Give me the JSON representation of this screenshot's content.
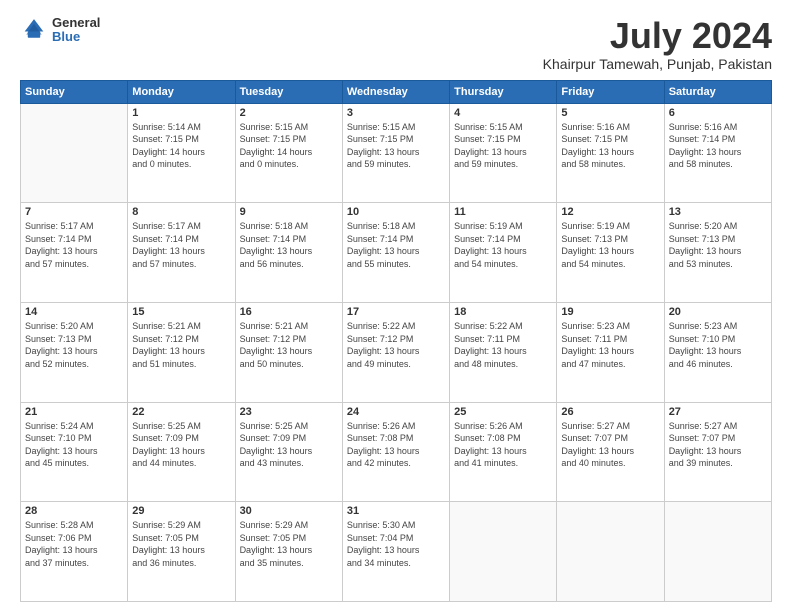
{
  "logo": {
    "line1": "General",
    "line2": "Blue"
  },
  "title": "July 2024",
  "location": "Khairpur Tamewah, Punjab, Pakistan",
  "headers": [
    "Sunday",
    "Monday",
    "Tuesday",
    "Wednesday",
    "Thursday",
    "Friday",
    "Saturday"
  ],
  "weeks": [
    [
      {
        "day": "",
        "info": ""
      },
      {
        "day": "1",
        "info": "Sunrise: 5:14 AM\nSunset: 7:15 PM\nDaylight: 14 hours\nand 0 minutes."
      },
      {
        "day": "2",
        "info": "Sunrise: 5:15 AM\nSunset: 7:15 PM\nDaylight: 14 hours\nand 0 minutes."
      },
      {
        "day": "3",
        "info": "Sunrise: 5:15 AM\nSunset: 7:15 PM\nDaylight: 13 hours\nand 59 minutes."
      },
      {
        "day": "4",
        "info": "Sunrise: 5:15 AM\nSunset: 7:15 PM\nDaylight: 13 hours\nand 59 minutes."
      },
      {
        "day": "5",
        "info": "Sunrise: 5:16 AM\nSunset: 7:15 PM\nDaylight: 13 hours\nand 58 minutes."
      },
      {
        "day": "6",
        "info": "Sunrise: 5:16 AM\nSunset: 7:14 PM\nDaylight: 13 hours\nand 58 minutes."
      }
    ],
    [
      {
        "day": "7",
        "info": "Sunrise: 5:17 AM\nSunset: 7:14 PM\nDaylight: 13 hours\nand 57 minutes."
      },
      {
        "day": "8",
        "info": "Sunrise: 5:17 AM\nSunset: 7:14 PM\nDaylight: 13 hours\nand 57 minutes."
      },
      {
        "day": "9",
        "info": "Sunrise: 5:18 AM\nSunset: 7:14 PM\nDaylight: 13 hours\nand 56 minutes."
      },
      {
        "day": "10",
        "info": "Sunrise: 5:18 AM\nSunset: 7:14 PM\nDaylight: 13 hours\nand 55 minutes."
      },
      {
        "day": "11",
        "info": "Sunrise: 5:19 AM\nSunset: 7:14 PM\nDaylight: 13 hours\nand 54 minutes."
      },
      {
        "day": "12",
        "info": "Sunrise: 5:19 AM\nSunset: 7:13 PM\nDaylight: 13 hours\nand 54 minutes."
      },
      {
        "day": "13",
        "info": "Sunrise: 5:20 AM\nSunset: 7:13 PM\nDaylight: 13 hours\nand 53 minutes."
      }
    ],
    [
      {
        "day": "14",
        "info": "Sunrise: 5:20 AM\nSunset: 7:13 PM\nDaylight: 13 hours\nand 52 minutes."
      },
      {
        "day": "15",
        "info": "Sunrise: 5:21 AM\nSunset: 7:12 PM\nDaylight: 13 hours\nand 51 minutes."
      },
      {
        "day": "16",
        "info": "Sunrise: 5:21 AM\nSunset: 7:12 PM\nDaylight: 13 hours\nand 50 minutes."
      },
      {
        "day": "17",
        "info": "Sunrise: 5:22 AM\nSunset: 7:12 PM\nDaylight: 13 hours\nand 49 minutes."
      },
      {
        "day": "18",
        "info": "Sunrise: 5:22 AM\nSunset: 7:11 PM\nDaylight: 13 hours\nand 48 minutes."
      },
      {
        "day": "19",
        "info": "Sunrise: 5:23 AM\nSunset: 7:11 PM\nDaylight: 13 hours\nand 47 minutes."
      },
      {
        "day": "20",
        "info": "Sunrise: 5:23 AM\nSunset: 7:10 PM\nDaylight: 13 hours\nand 46 minutes."
      }
    ],
    [
      {
        "day": "21",
        "info": "Sunrise: 5:24 AM\nSunset: 7:10 PM\nDaylight: 13 hours\nand 45 minutes."
      },
      {
        "day": "22",
        "info": "Sunrise: 5:25 AM\nSunset: 7:09 PM\nDaylight: 13 hours\nand 44 minutes."
      },
      {
        "day": "23",
        "info": "Sunrise: 5:25 AM\nSunset: 7:09 PM\nDaylight: 13 hours\nand 43 minutes."
      },
      {
        "day": "24",
        "info": "Sunrise: 5:26 AM\nSunset: 7:08 PM\nDaylight: 13 hours\nand 42 minutes."
      },
      {
        "day": "25",
        "info": "Sunrise: 5:26 AM\nSunset: 7:08 PM\nDaylight: 13 hours\nand 41 minutes."
      },
      {
        "day": "26",
        "info": "Sunrise: 5:27 AM\nSunset: 7:07 PM\nDaylight: 13 hours\nand 40 minutes."
      },
      {
        "day": "27",
        "info": "Sunrise: 5:27 AM\nSunset: 7:07 PM\nDaylight: 13 hours\nand 39 minutes."
      }
    ],
    [
      {
        "day": "28",
        "info": "Sunrise: 5:28 AM\nSunset: 7:06 PM\nDaylight: 13 hours\nand 37 minutes."
      },
      {
        "day": "29",
        "info": "Sunrise: 5:29 AM\nSunset: 7:05 PM\nDaylight: 13 hours\nand 36 minutes."
      },
      {
        "day": "30",
        "info": "Sunrise: 5:29 AM\nSunset: 7:05 PM\nDaylight: 13 hours\nand 35 minutes."
      },
      {
        "day": "31",
        "info": "Sunrise: 5:30 AM\nSunset: 7:04 PM\nDaylight: 13 hours\nand 34 minutes."
      },
      {
        "day": "",
        "info": ""
      },
      {
        "day": "",
        "info": ""
      },
      {
        "day": "",
        "info": ""
      }
    ]
  ]
}
